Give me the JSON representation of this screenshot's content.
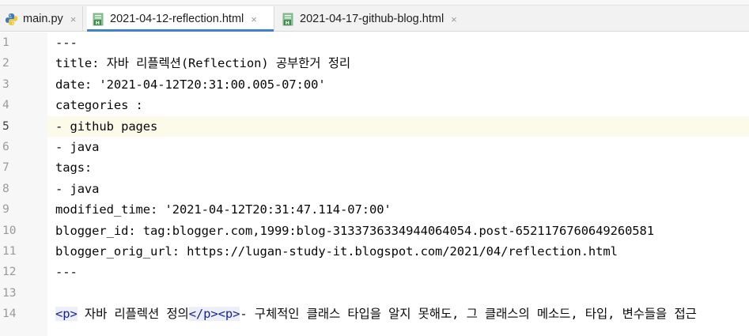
{
  "tabs": [
    {
      "label": "main.py",
      "icon": "python-file-icon",
      "active": false
    },
    {
      "label": "2021-04-12-reflection.html",
      "icon": "html-file-icon",
      "active": true
    },
    {
      "label": "2021-04-17-github-blog.html",
      "icon": "html-file-icon",
      "active": false
    }
  ],
  "close_glyph": "×",
  "colors": {
    "accent": "#4083c9",
    "current_line": "#fcfae9",
    "html_tag": "#1a2390"
  },
  "editor": {
    "current_line": 5,
    "lines": [
      {
        "n": "1",
        "text": "---"
      },
      {
        "n": "2",
        "text": "title: 자바 리플렉션(Reflection) 공부한거 정리"
      },
      {
        "n": "3",
        "text": "date: '2021-04-12T20:31:00.005-07:00'"
      },
      {
        "n": "4",
        "text": "categories :"
      },
      {
        "n": "5",
        "text": "- github pages"
      },
      {
        "n": "6",
        "text": "- java"
      },
      {
        "n": "7",
        "text": "tags:"
      },
      {
        "n": "8",
        "text": "- java"
      },
      {
        "n": "9",
        "text": "modified_time: '2021-04-12T20:31:47.114-07:00'"
      },
      {
        "n": "10",
        "text": "blogger_id: tag:blogger.com,1999:blog-3133736334944064054.post-6521176760649260581"
      },
      {
        "n": "11",
        "text": "blogger_orig_url: https://lugan-study-it.blogspot.com/2021/04/reflection.html"
      },
      {
        "n": "12",
        "text": "---"
      },
      {
        "n": "13",
        "text": ""
      }
    ],
    "line14": {
      "n": "14",
      "open_p": "<p>",
      "text1": " 자바 리플렉션 정의",
      "close_p": "</p>",
      "open_p2": "<p>",
      "text2": "- 구체적인 클래스 타입을 알지 못해도, 그 클래스의 메소드, 타입, 변수들을 접근"
    }
  }
}
